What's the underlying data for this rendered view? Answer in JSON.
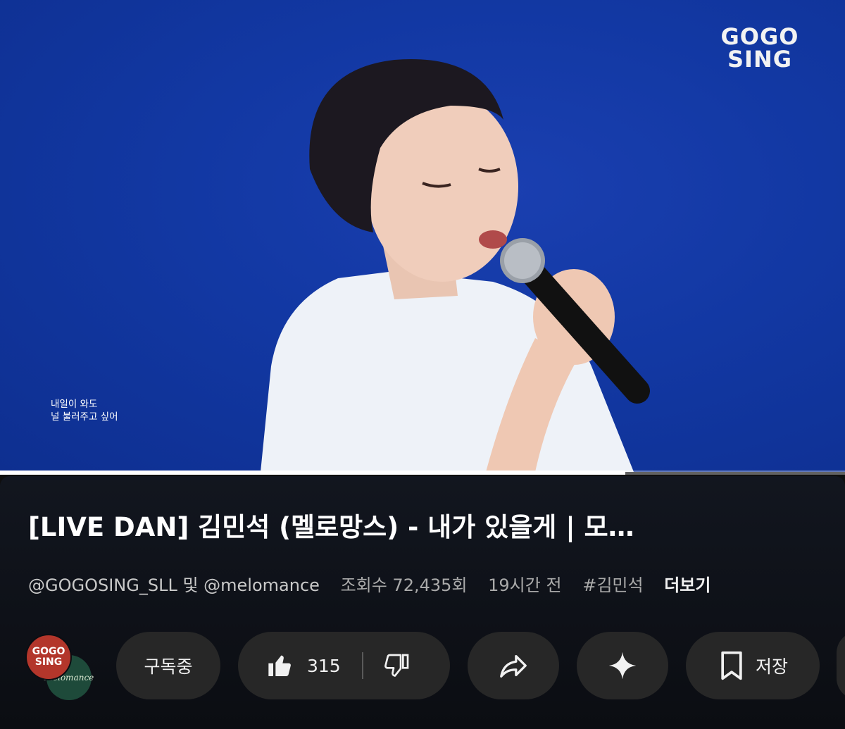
{
  "video": {
    "logo_line1": "GOGO",
    "logo_line2": "SING",
    "subtitle_line1": "내일이 와도",
    "subtitle_line2": "널 불러주고 싶어",
    "progress_fraction": 0.74
  },
  "title": "[LIVE DAN] 김민석 (멜로망스) - 내가 있을게 | 모…",
  "meta": {
    "channels": "@GOGOSING_SLL 및 @melomance",
    "views": "조회수 72,435회",
    "time": "19시간 전",
    "hashtag": "#김민석",
    "more": "더보기"
  },
  "avatars": {
    "front_line1": "GOGO",
    "front_line2": "SING",
    "back_text": "Melomance"
  },
  "actions": {
    "subscribe_label": "구독중",
    "like_count": "315",
    "save_label": "저장"
  },
  "icons": {
    "like": "thumbs-up-icon",
    "dislike": "thumbs-down-icon",
    "share": "share-icon",
    "remix": "sparkle-icon",
    "save": "bookmark-icon"
  }
}
